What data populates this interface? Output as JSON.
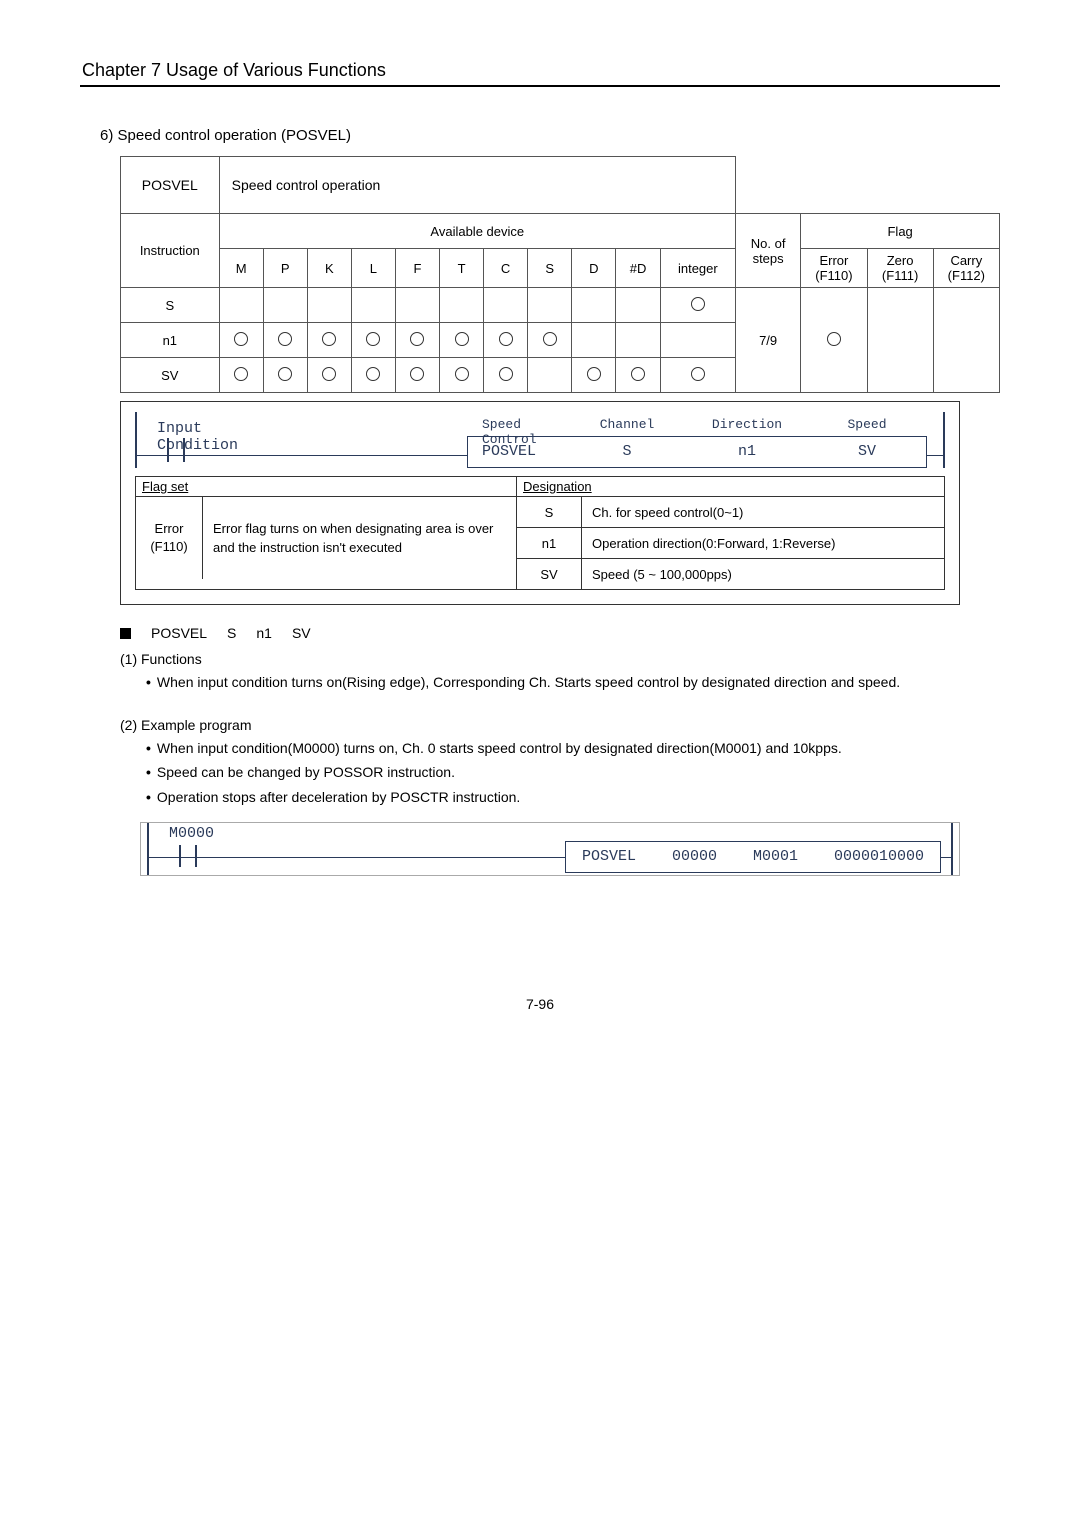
{
  "chapter_title": "Chapter 7   Usage of Various Functions",
  "section_title": "6) Speed control operation (POSVEL)",
  "instruction_table": {
    "name_label": "POSVEL",
    "name_desc": "Speed control operation",
    "instruction_label": "Instruction",
    "available_header": "Available device",
    "noof_header": "No. of",
    "steps_header": "steps",
    "flag_header": "Flag",
    "cols": [
      "M",
      "P",
      "K",
      "L",
      "F",
      "T",
      "C",
      "S",
      "D",
      "#D",
      "integer"
    ],
    "flag_cols": {
      "error": "Error",
      "error_sub": "(F110)",
      "zero": "Zero",
      "zero_sub": "(F111)",
      "carry": "Carry",
      "carry_sub": "(F112)"
    },
    "rows": [
      {
        "label": "S",
        "marks": [
          "",
          "",
          "",
          "",
          "",
          "",
          "",
          "",
          "",
          "",
          "o"
        ]
      },
      {
        "label": "n1",
        "marks": [
          "o",
          "o",
          "o",
          "o",
          "o",
          "o",
          "o",
          "o",
          "",
          "",
          ""
        ]
      },
      {
        "label": "SV",
        "marks": [
          "o",
          "o",
          "o",
          "o",
          "o",
          "o",
          "o",
          "",
          "o",
          "o",
          "o"
        ]
      }
    ],
    "steps_value": "7/9",
    "flag_marks": {
      "error": "o",
      "zero": "",
      "carry": ""
    }
  },
  "ladder1": {
    "input_label_top": "Input",
    "input_label_bottom": "Condition",
    "headers": {
      "c1_top": "Speed",
      "c1_bot": "Control",
      "c2": "Channel",
      "c3": "Direction",
      "c4": "Speed"
    },
    "fields": [
      "POSVEL",
      "S",
      "n1",
      "SV"
    ]
  },
  "flag_set": {
    "title": "Flag set",
    "left_line1": "Error",
    "left_line2": "(F110)",
    "desc": "Error flag turns on when designating area is over and the instruction isn't executed"
  },
  "designation": {
    "title": "Designation",
    "rows": [
      {
        "k": "S",
        "v": "Ch. for speed control(0~1)"
      },
      {
        "k": "n1",
        "v": "Operation direction(0:Forward, 1:Reverse)"
      },
      {
        "k": "SV",
        "v": "Speed (5 ~ 100,000pps)"
      }
    ]
  },
  "syntax": {
    "mnemonic": "POSVEL",
    "a": "S",
    "b": "n1",
    "c": "SV"
  },
  "functions": {
    "header": "(1) Functions",
    "bullet1": "When input condition turns on(Rising edge), Corresponding Ch. Starts speed control by designated direction and speed."
  },
  "example": {
    "header": "(2) Example program",
    "b1": "When input condition(M0000) turns on, Ch. 0 starts speed control by designated direction(M0001) and 10kpps.",
    "b2": "Speed can be changed by POSSOR instruction.",
    "b3": "Operation stops after deceleration by POSCTR instruction."
  },
  "ladder2": {
    "contact": "M0000",
    "fields": [
      "POSVEL",
      "00000",
      "M0001",
      "0000010000"
    ]
  },
  "page_number": "7-96"
}
